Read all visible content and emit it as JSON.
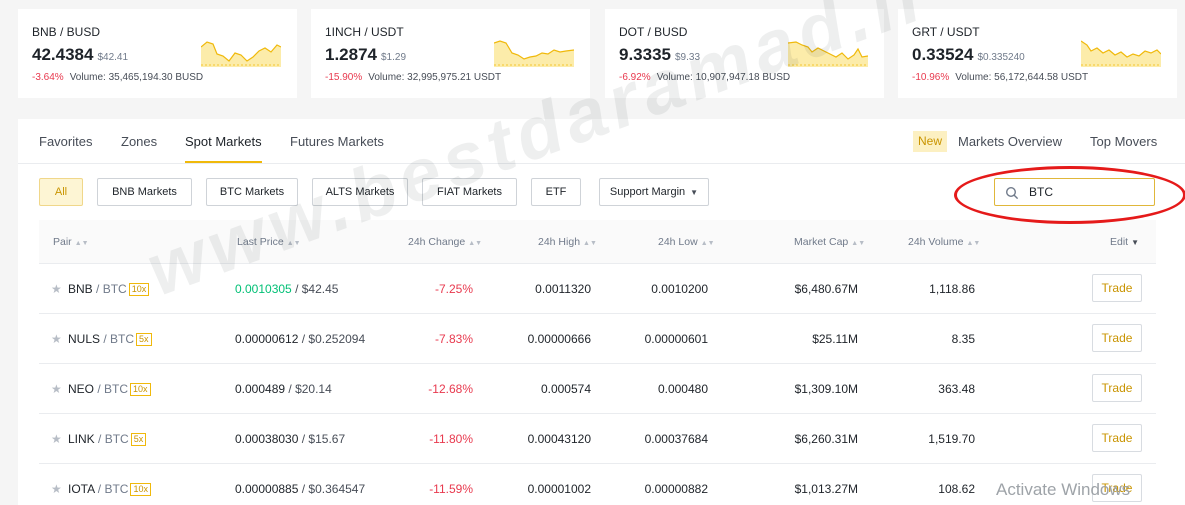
{
  "cards": [
    {
      "pair": "BNB / BUSD",
      "price": "42.4384",
      "fiat": "$42.41",
      "change": "-3.64%",
      "volume": "Volume: 35,465,194.30 BUSD"
    },
    {
      "pair": "1INCH / USDT",
      "price": "1.2874",
      "fiat": "$1.29",
      "change": "-15.90%",
      "volume": "Volume: 32,995,975.21 USDT"
    },
    {
      "pair": "DOT / BUSD",
      "price": "9.3335",
      "fiat": "$9.33",
      "change": "-6.92%",
      "volume": "Volume: 10,907,947.18 BUSD"
    },
    {
      "pair": "GRT / USDT",
      "price": "0.33524",
      "fiat": "$0.335240",
      "change": "-10.96%",
      "volume": "Volume: 56,172,644.58 USDT"
    }
  ],
  "tabs": [
    "Favorites",
    "Zones",
    "Spot Markets",
    "Futures Markets"
  ],
  "right_tabs": {
    "new_badge": "New",
    "overview": "Markets Overview",
    "top_movers": "Top Movers"
  },
  "filters": [
    "All",
    "BNB Markets",
    "BTC Markets",
    "ALTS Markets",
    "FIAT Markets",
    "ETF"
  ],
  "margin_dropdown": "Support Margin",
  "search": {
    "value": "BTC"
  },
  "columns": {
    "pair": "Pair",
    "last_price": "Last Price",
    "change": "24h Change",
    "high": "24h High",
    "low": "24h Low",
    "market_cap": "Market Cap",
    "volume": "24h Volume",
    "edit": "Edit"
  },
  "rows": [
    {
      "base": "BNB",
      "quote": "/ BTC",
      "leverage": "10x",
      "price": "0.0010305",
      "fiat": "/ $42.45",
      "change": "-7.25%",
      "high": "0.0011320",
      "low": "0.0010200",
      "market_cap": "$6,480.67M",
      "volume": "1,118.86",
      "trade": "Trade"
    },
    {
      "base": "NULS",
      "quote": "/ BTC",
      "leverage": "5x",
      "price": "0.00000612",
      "fiat": "/ $0.252094",
      "change": "-7.83%",
      "high": "0.00000666",
      "low": "0.00000601",
      "market_cap": "$25.11M",
      "volume": "8.35",
      "trade": "Trade"
    },
    {
      "base": "NEO",
      "quote": "/ BTC",
      "leverage": "10x",
      "price": "0.000489",
      "fiat": "/ $20.14",
      "change": "-12.68%",
      "high": "0.000574",
      "low": "0.000480",
      "market_cap": "$1,309.10M",
      "volume": "363.48",
      "trade": "Trade"
    },
    {
      "base": "LINK",
      "quote": "/ BTC",
      "leverage": "5x",
      "price": "0.00038030",
      "fiat": "/ $15.67",
      "change": "-11.80%",
      "high": "0.00043120",
      "low": "0.00037684",
      "market_cap": "$6,260.31M",
      "volume": "1,519.70",
      "trade": "Trade"
    },
    {
      "base": "IOTA",
      "quote": "/ BTC",
      "leverage": "10x",
      "price": "0.00000885",
      "fiat": "/ $0.364547",
      "change": "-11.59%",
      "high": "0.00001002",
      "low": "0.00000882",
      "market_cap": "$1,013.27M",
      "volume": "108.62",
      "trade": "Trade"
    }
  ],
  "watermark": "www.bestdaramad.ir",
  "activate_text": "Activate Windows",
  "colors": {
    "accent": "#f0b90b",
    "down": "#e8394e",
    "up": "#02c076",
    "highlight_ellipse": "#e51a1a"
  }
}
